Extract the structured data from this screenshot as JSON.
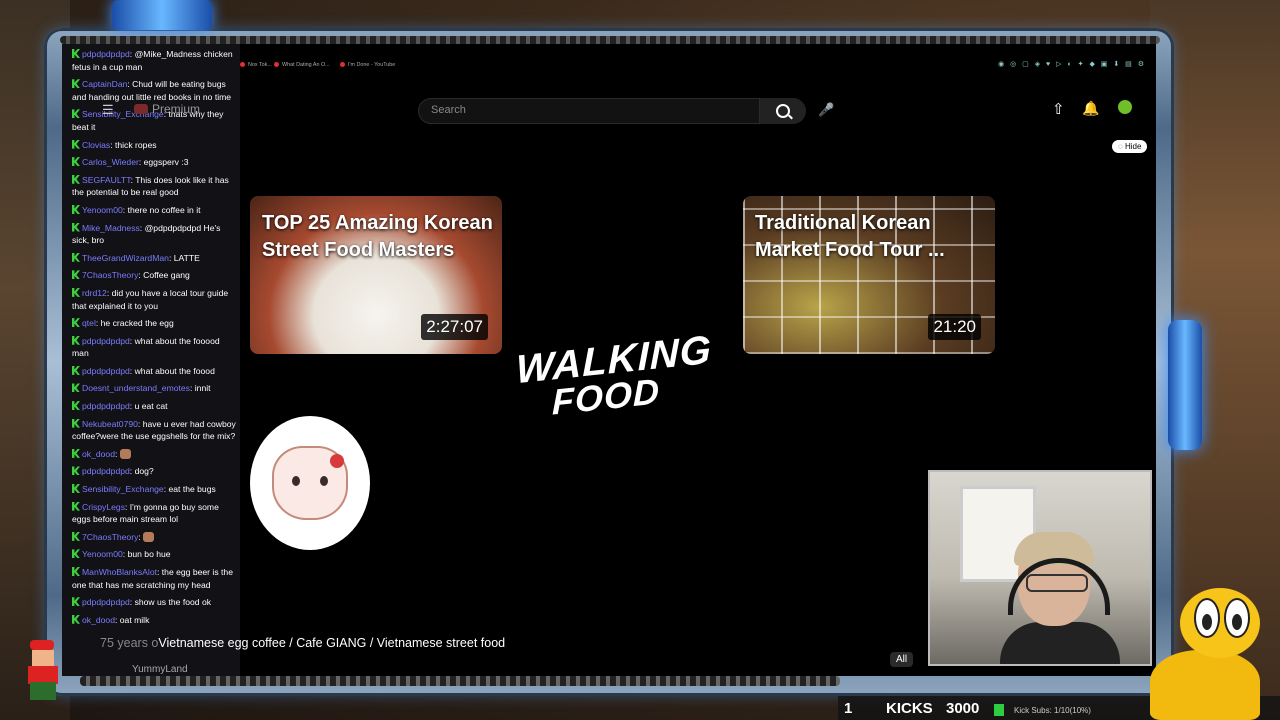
{
  "chat": {
    "messages": [
      {
        "user": "pdpdpdpdpd",
        "text": "@Mike_Madness chicken fetus in a cup man"
      },
      {
        "user": "CaptainDan",
        "text": "Chud will be eating bugs and handing out little red books in no time"
      },
      {
        "user": "Sensibility_Exchange",
        "text": "thats why they beat it"
      },
      {
        "user": "Clovias",
        "text": "thick ropes"
      },
      {
        "user": "Carlos_Wieder",
        "text": "eggsperv :3"
      },
      {
        "user": "SEGFAULTT",
        "text": "This does look like it has the potential to be real good"
      },
      {
        "user": "Yenoom00",
        "text": "there no coffee in it"
      },
      {
        "user": "Mike_Madness",
        "text": "@pdpdpdpdpd He's sick, bro"
      },
      {
        "user": "TheeGrandWizardMan",
        "text": "LATTE"
      },
      {
        "user": "7ChaosTheory",
        "text": "Coffee gang"
      },
      {
        "user": "rdrd12",
        "text": "did you have a local tour guide that explained it to you"
      },
      {
        "user": "qtel",
        "text": "he cracked the egg"
      },
      {
        "user": "pdpdpdpdpd",
        "text": "what about the fooood man"
      },
      {
        "user": "pdpdpdpdpd",
        "text": "what about the foood"
      },
      {
        "user": "Doesnt_understand_emotes",
        "text": "innit"
      },
      {
        "user": "pdpdpdpdpd",
        "text": "u eat cat"
      },
      {
        "user": "Nekubeat0790",
        "text": "have u ever had cowboy coffee?were the use eggshells for the mix?"
      },
      {
        "user": "ok_dood",
        "text": ""
      },
      {
        "user": "pdpdpdpdpd",
        "text": "dog?"
      },
      {
        "user": "Sensibility_Exchange",
        "text": "eat the bugs"
      },
      {
        "user": "CrispyLegs",
        "text": "I'm gonna go buy some eggs before main stream lol"
      },
      {
        "user": "7ChaosTheory",
        "text": ""
      },
      {
        "user": "Yenoom00",
        "text": "bun bo hue"
      },
      {
        "user": "ManWhoBlanksAlot",
        "text": "the egg beer is the one that has me scratching my head"
      },
      {
        "user": "pdpdpdpdpd",
        "text": "show us the food ok"
      },
      {
        "user": "ok_dood",
        "text": "oat milk"
      }
    ]
  },
  "browser": {
    "tabs": [
      "Nox Tok...",
      "What Dating An O...",
      "I'm Done - YouTube"
    ]
  },
  "youtube": {
    "logo_text": "Premium",
    "search_placeholder": "Search",
    "hide_label": "Hide"
  },
  "videos": [
    {
      "title": "TOP 25 Amazing Korean Street Food Masters",
      "duration": "2:27:07"
    },
    {
      "title": "Traditional Korean Market Food Tour ...",
      "duration": "21:20"
    }
  ],
  "logo": {
    "line1": "WALKING",
    "line2": "FOOD"
  },
  "bottom": {
    "title_prefix": "75 years o",
    "title": "Vietnamese egg coffee / Cafe GIANG / Vietnamese street food",
    "channel": "YummyLand",
    "chip": "All"
  },
  "overlay": {
    "kicks_count": "1",
    "kicks_label": "KICKS",
    "kicks_value": "3000",
    "sub_text": "Kick Subs: 1/10(10%)",
    "sub_right": "10"
  }
}
